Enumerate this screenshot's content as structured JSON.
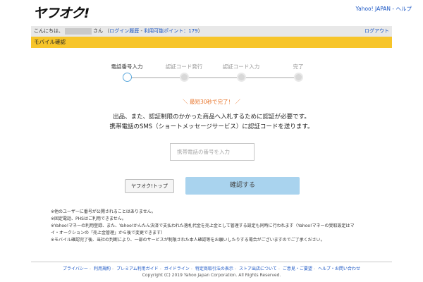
{
  "header": {
    "logo": "ヤフオク!",
    "yahoo_japan": "Yahoo! JAPAN",
    "sep": " - ",
    "help": "ヘルプ"
  },
  "greeting": {
    "hello": "こんにちは、",
    "san": "さん",
    "open_paren": "（",
    "login_history": "ログイン履歴",
    "dash": " - ",
    "points_label": "利用可能ポイント：",
    "points_value": "179",
    "close_paren": "）",
    "logout": "ログアウト"
  },
  "page_title": "モバイル確認",
  "steps": [
    {
      "label": "電話番号入力",
      "active": true
    },
    {
      "label": "認証コード発行",
      "active": false
    },
    {
      "label": "認証コード入力",
      "active": false
    },
    {
      "label": "完了",
      "active": false
    }
  ],
  "promo": "＼ 最短30秒で完了！ ／",
  "description": [
    "出品、また、認証制限のかかった商品へ入札するために認証が必要です。",
    "携帯電話のSMS（ショートメッセージサービス）に認証コードを送ります。"
  ],
  "phone_input": {
    "placeholder": "携帯電話の番号を入力",
    "value": ""
  },
  "buttons": {
    "top": "ヤフオク!トップ",
    "confirm": "確認する"
  },
  "notes": [
    "※他のユーザーに番号が公開されることはありません。",
    "※固定電話、PHSはご利用できません。",
    "※Yahoo!マネーの利用登録、また、Yahoo!かんたん決済で支払われた落札代金を売上金として管理する設定も同時に行われます（Yahoo!マネーの受取設定はマ",
    "イ・オークションの「売上金管理」から後で変更できます）",
    "※モバイル確認完了後、当社の判断により、一部のサービスが制限された本人確認等をお願いしたりする場合がございますのでご了承ください。"
  ],
  "notes_link": "Yahoo!マネー",
  "footer": {
    "links": [
      "プライバシー",
      "利用規約",
      "プレミアム利用ガイド",
      "ガイドライン",
      "特定商取引法の表示",
      "ストア出店について",
      "ご意見・ご要望",
      "ヘルプ・お問い合わせ"
    ],
    "copyright": "Copyright (C) 2019 Yahoo Japan Corporation. All Rights Reserved."
  }
}
